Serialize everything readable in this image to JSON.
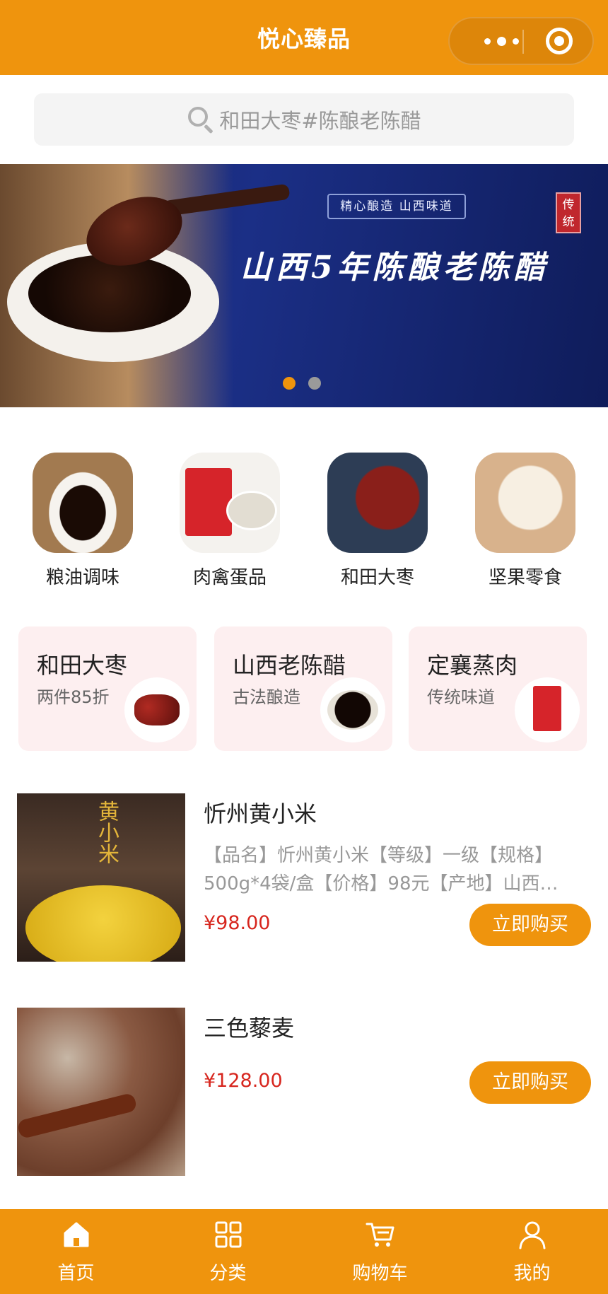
{
  "header": {
    "title": "悦心臻品"
  },
  "search": {
    "placeholder": "和田大枣#陈酿老陈醋"
  },
  "banner": {
    "tagline": "精心酿造 山西味道",
    "headline": "山西5年陈酿老陈醋",
    "seal": "传统",
    "active_slide": 1,
    "slide_count": 2
  },
  "categories": [
    {
      "label": "粮油调味",
      "icon": "vinegar-bowl"
    },
    {
      "label": "肉禽蛋品",
      "icon": "meat-pack"
    },
    {
      "label": "和田大枣",
      "icon": "red-dates"
    },
    {
      "label": "坚果零食",
      "icon": "nuts"
    }
  ],
  "promos": [
    {
      "title": "和田大枣",
      "subtitle": "两件85折"
    },
    {
      "title": "山西老陈醋",
      "subtitle": "古法酿造"
    },
    {
      "title": "定襄蒸肉",
      "subtitle": "传统味道"
    }
  ],
  "products": [
    {
      "title": "忻州黄小米",
      "desc_line1": "【品名】忻州黄小米【等级】一级【规格】",
      "desc_line2": "500g*4袋/盒【价格】98元【产地】山西…",
      "price": "¥98.00",
      "buy_label": "立即购买",
      "image_brand": "黄小米"
    },
    {
      "title": "三色藜麦",
      "price": "¥128.00",
      "buy_label": "立即购买"
    }
  ],
  "tabbar": [
    {
      "label": "首页",
      "icon": "home-icon"
    },
    {
      "label": "分类",
      "icon": "grid-icon"
    },
    {
      "label": "购物车",
      "icon": "cart-icon"
    },
    {
      "label": "我的",
      "icon": "user-icon"
    }
  ],
  "colors": {
    "accent": "#ef940d",
    "price": "#d7261e",
    "promo_bg": "#fdeff0"
  }
}
